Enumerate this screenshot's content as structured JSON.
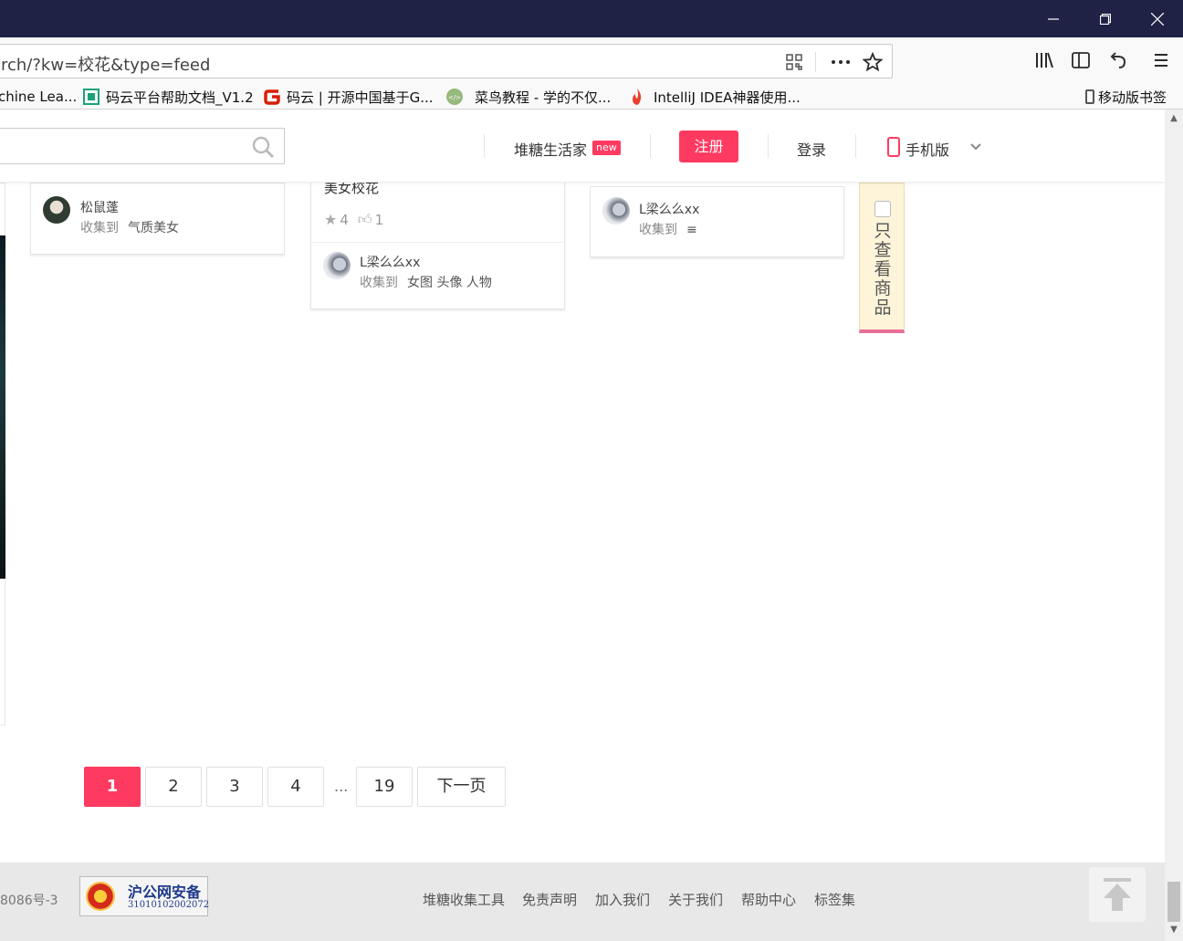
{
  "browser": {
    "url": "rch/?kw=校花&type=feed",
    "bookmarks": [
      {
        "label": "chine Lea..."
      },
      {
        "label": "码云平台帮助文档_V1.2"
      },
      {
        "label": "码云 | 开源中国基于G..."
      },
      {
        "label": "菜鸟教程 - 学的不仅..."
      },
      {
        "label": "IntelliJ IDEA神器使用..."
      }
    ],
    "mobile_bookmarks": "移动版书签"
  },
  "header": {
    "life_label": "堆糖生活家",
    "new_badge": "new",
    "register": "注册",
    "login": "登录",
    "mobile": "手机版"
  },
  "cards": [
    {
      "user": "松鼠蓬",
      "collect_label": "收集到",
      "tags": "气质美女"
    },
    {
      "title": "美女校花",
      "stars": "4",
      "likes": "1",
      "user": "L梁么么xx",
      "collect_label": "收集到",
      "tags": "女图 头像 人物"
    },
    {
      "user": "L梁么么xx",
      "collect_label": "收集到",
      "tags": "≡"
    }
  ],
  "filter": {
    "label": "只查看商品"
  },
  "pagination": {
    "pages": [
      "1",
      "2",
      "3",
      "4"
    ],
    "ellipsis": "...",
    "last": "19",
    "next": "下一页"
  },
  "footer": {
    "icp": "8086号-3",
    "police_badge_title": "沪公网安备",
    "police_badge_number": "31010102002072",
    "links": [
      "堆糖收集工具",
      "免责声明",
      "加入我们",
      "关于我们",
      "帮助中心",
      "标签集"
    ]
  },
  "colors": {
    "accent": "#ff3a60",
    "titlebar": "#1f2245",
    "filter_bg": "#fdf4d9"
  }
}
